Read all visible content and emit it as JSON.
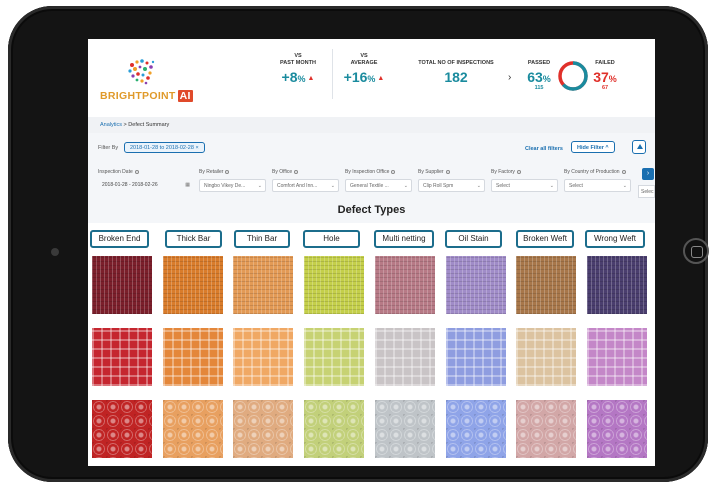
{
  "brand": {
    "name": "BRIGHTPOINT",
    "suffix": "AI"
  },
  "stats": {
    "past_month": {
      "caption_top": "VS",
      "caption": "PAST MONTH",
      "value": "+8",
      "unit": "%"
    },
    "average": {
      "caption_top": "VS",
      "caption": "AVERAGE",
      "value": "+16",
      "unit": "%"
    },
    "total": {
      "caption": "TOTAL NO OF INSPECTIONS",
      "value": "182"
    },
    "passed": {
      "caption": "PASSED",
      "value": "63",
      "unit": "%",
      "count": "115"
    },
    "failed": {
      "caption": "FAILED",
      "value": "37",
      "unit": "%",
      "count": "67"
    },
    "passed_fraction": 0.63,
    "colors": {
      "passed": "#1a8b9e",
      "failed": "#e0302a"
    }
  },
  "breadcrumb": {
    "root": "Analytics",
    "separator": ">",
    "current": "Defect Summary"
  },
  "filters": {
    "label": "Filter By",
    "date_chip": "2018-01-28 to 2018-02-28 ×",
    "clear_all": "Clear all filters",
    "hide_filter": "Hide Filter ^",
    "fields": [
      {
        "label": "Inspection Date",
        "value": "2018-01-28  -  2018-02-26"
      },
      {
        "label": "By Retailer",
        "value": "Ningbo Vikey De..."
      },
      {
        "label": "By Office",
        "value": "Comfort And Inn..."
      },
      {
        "label": "By Inspection Office",
        "value": "General Textile ..."
      },
      {
        "label": "By Supplier",
        "value": "Clip Roll Spm"
      },
      {
        "label": "By Factory",
        "value": "Select"
      },
      {
        "label": "By Country of Production",
        "value": "Select"
      }
    ],
    "overflow_value": "Selec"
  },
  "defects": {
    "title": "Defect Types",
    "types": [
      {
        "label": "Broken End",
        "color": "#7b1f2b"
      },
      {
        "label": "Thick Bar",
        "color": "#d97c2b"
      },
      {
        "label": "Thin Bar",
        "color": "#e39a55"
      },
      {
        "label": "Hole",
        "color": "#c4cf4a"
      },
      {
        "label": "Multi netting",
        "color": "#b77a86"
      },
      {
        "label": "Oil Stain",
        "color": "#a08cc8"
      },
      {
        "label": "Broken Weft",
        "color": "#a8774a"
      },
      {
        "label": "Wrong Weft",
        "color": "#4a3e6e"
      }
    ],
    "row_colors": [
      [
        "#7b1f2b",
        "#d97c2b",
        "#e39a55",
        "#c4cf4a",
        "#b77a86",
        "#a08cc8",
        "#a8774a",
        "#4a3e6e"
      ],
      [
        "#c5262f",
        "#e4873a",
        "#f0a864",
        "#c7d273",
        "#c9c4c6",
        "#8f9de0",
        "#dcc3a0",
        "#c487c8"
      ],
      [
        "#c02424",
        "#e8a060",
        "#e0ab80",
        "#c2d07a",
        "#bfc4c8",
        "#8fa4e8",
        "#d2a7a7",
        "#b477c4"
      ]
    ]
  }
}
